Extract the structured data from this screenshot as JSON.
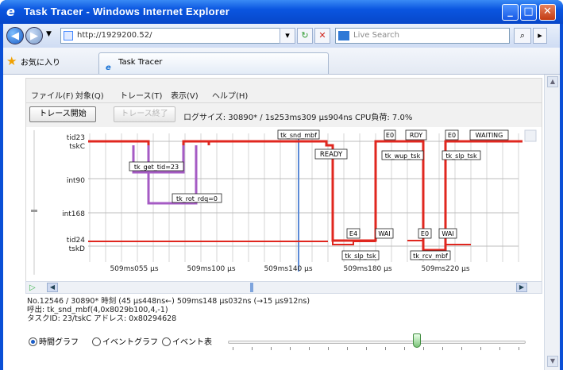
{
  "window": {
    "title": "Task Tracer - Windows Internet Explorer"
  },
  "nav": {
    "url": "http://1929200.52/",
    "search_placeholder": "Live Search"
  },
  "favorites": {
    "label": "お気に入り",
    "tab_title": "Task Tracer"
  },
  "menu": {
    "items": [
      "ファイル(F)",
      "対象(Q)",
      "トレース(T)",
      "表示(V)",
      "ヘルプ(H)"
    ]
  },
  "toolbar": {
    "start_label": "トレース開始",
    "stop_label": "トレース終了",
    "log_info": "ログサイズ: 30890* / 1s253ms309 μs904ns   CPU負荷: 7.0%"
  },
  "chart_data": {
    "type": "timeline",
    "rows": [
      "tid23\ntskC",
      "int90",
      "int168",
      "tid24\ntskD"
    ],
    "row_labels": [
      [
        "tid23",
        "tskC"
      ],
      [
        "int90"
      ],
      [
        "int168"
      ],
      [
        "tid24",
        "tskD"
      ]
    ],
    "x_ticks": [
      "509ms055 μs",
      "509ms100 μs",
      "509ms140 μs",
      "509ms180 μs",
      "509ms220 μs"
    ],
    "events": [
      "tk_snd_mbf",
      "READY",
      "E0",
      "RDY",
      "tk_wup_tsk",
      "E0",
      "WAITING",
      "tk_slp_tsk",
      "tk_get_tid=23",
      "tk_rot_rdq=0",
      "E4",
      "WAI",
      "tk_slp_tsk",
      "E0",
      "WAI",
      "tk_rcv_mbf"
    ]
  },
  "info": {
    "line1": "No.12546 / 30890*  時刻 (45 μs448ns←) 509ms148 μs032ns (→15 μs912ns)",
    "line2": "呼出: tk_snd_mbf(4,0x8029b100,4,-1)",
    "line3": "タスクID: 23/tskC  アドレス: 0x80294628"
  },
  "view_options": {
    "time_graph": "時間グラフ",
    "event_graph": "イベントグラフ",
    "event_table": "イベント表"
  },
  "colors": {
    "task_line": "#e0271f",
    "interrupt_line": "#a55bc4",
    "cursor_line": "#5b8ad6"
  }
}
